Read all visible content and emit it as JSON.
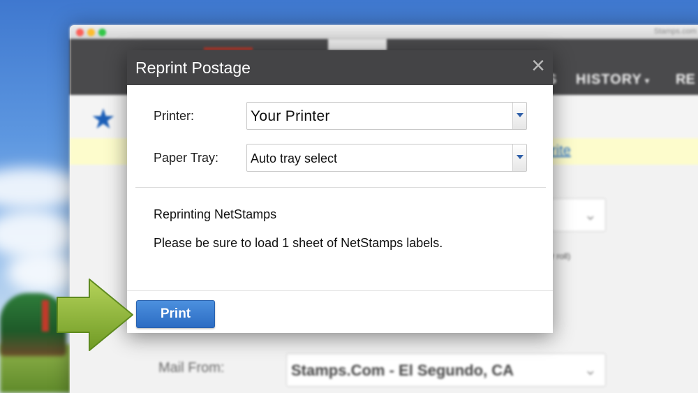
{
  "background": {
    "browser_title_url": "Stamps.com",
    "nav": {
      "partial_item": "S",
      "history_label": "HISTORY",
      "more_label": "RE"
    },
    "yellow_link_text": "rite",
    "small_note": "r roll)",
    "mail_from_label": "Mail From:",
    "mail_from_value": "Stamps.Com - El Segundo, CA"
  },
  "dialog": {
    "title": "Reprint Postage",
    "close_symbol": "×",
    "printer_label": "Printer:",
    "printer_value": "Your Printer",
    "paper_tray_label": "Paper Tray:",
    "paper_tray_value": "Auto tray select",
    "info_heading": "Reprinting NetStamps",
    "info_text": "Please be sure to load 1 sheet of NetStamps labels.",
    "print_button_label": "Print"
  },
  "icons": {
    "star": "star-icon",
    "close": "close-icon",
    "chevron": "chevron-down-icon",
    "arrow": "arrow-right-icon"
  },
  "colors": {
    "header_bg": "#444446",
    "button_blue": "#2c6cc3",
    "arrow_green": "#8cb83a",
    "star_blue": "#1c5fb8"
  }
}
